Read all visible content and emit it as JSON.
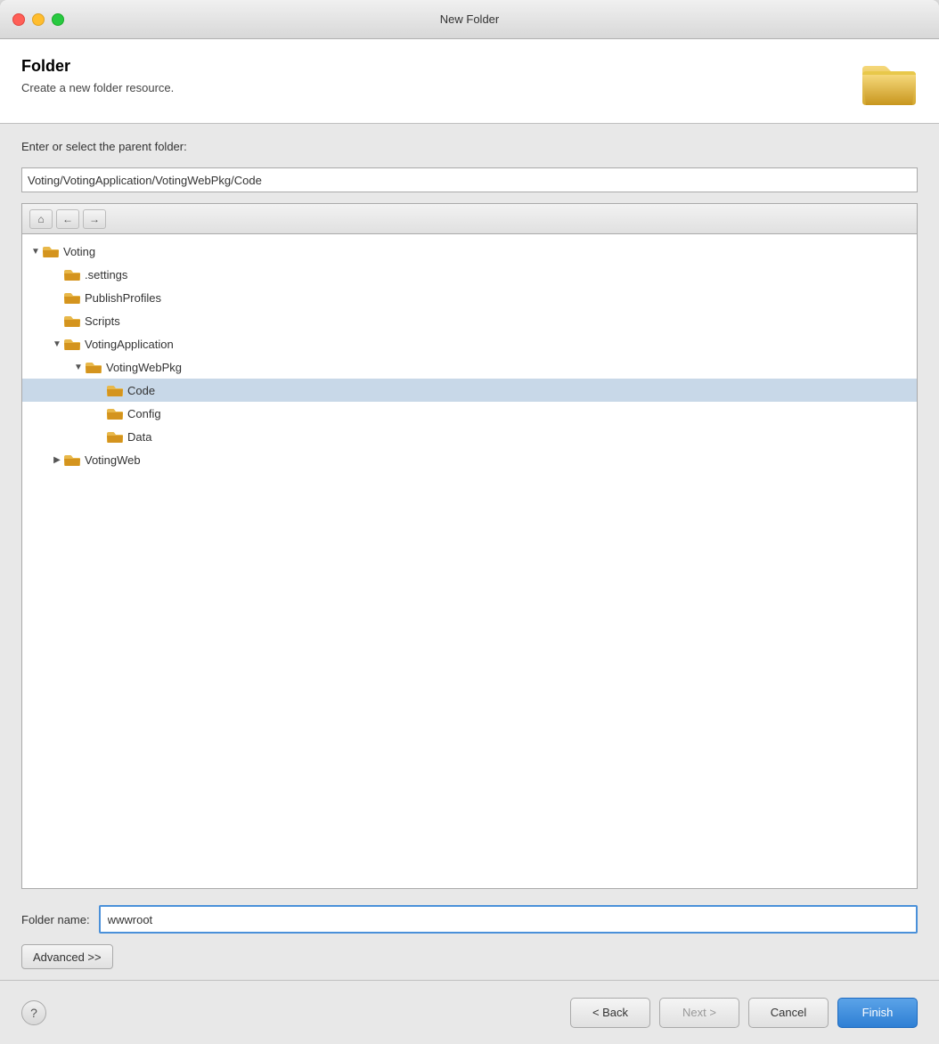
{
  "titleBar": {
    "title": "New Folder"
  },
  "header": {
    "title": "Folder",
    "description": "Create a new folder resource."
  },
  "content": {
    "parentFolderLabel": "Enter or select the parent folder:",
    "parentFolderPath": "Voting/VotingApplication/VotingWebPkg/Code",
    "treeToolbar": {
      "homeBtn": "⌂",
      "backBtn": "←",
      "forwardBtn": "→"
    },
    "treeItems": [
      {
        "id": "voting",
        "label": "Voting",
        "indent": 0,
        "expanded": true,
        "hasToggle": true,
        "selected": false,
        "isRoot": true
      },
      {
        "id": "settings",
        "label": ".settings",
        "indent": 1,
        "expanded": false,
        "hasToggle": false,
        "selected": false
      },
      {
        "id": "publishprofiles",
        "label": "PublishProfiles",
        "indent": 1,
        "expanded": false,
        "hasToggle": false,
        "selected": false
      },
      {
        "id": "scripts",
        "label": "Scripts",
        "indent": 1,
        "expanded": false,
        "hasToggle": false,
        "selected": false
      },
      {
        "id": "votingapplication",
        "label": "VotingApplication",
        "indent": 1,
        "expanded": true,
        "hasToggle": true,
        "selected": false
      },
      {
        "id": "votingwebpkg",
        "label": "VotingWebPkg",
        "indent": 2,
        "expanded": true,
        "hasToggle": true,
        "selected": false
      },
      {
        "id": "code",
        "label": "Code",
        "indent": 3,
        "expanded": false,
        "hasToggle": false,
        "selected": true
      },
      {
        "id": "config",
        "label": "Config",
        "indent": 3,
        "expanded": false,
        "hasToggle": false,
        "selected": false
      },
      {
        "id": "data",
        "label": "Data",
        "indent": 3,
        "expanded": false,
        "hasToggle": false,
        "selected": false
      },
      {
        "id": "votingweb",
        "label": "VotingWeb",
        "indent": 1,
        "expanded": false,
        "hasToggle": true,
        "selected": false
      }
    ]
  },
  "form": {
    "folderNameLabel": "Folder name:",
    "folderNameValue": "wwwroot",
    "advancedLabel": "Advanced >>"
  },
  "bottomBar": {
    "helpIcon": "?",
    "backLabel": "< Back",
    "nextLabel": "Next >",
    "cancelLabel": "Cancel",
    "finishLabel": "Finish"
  }
}
